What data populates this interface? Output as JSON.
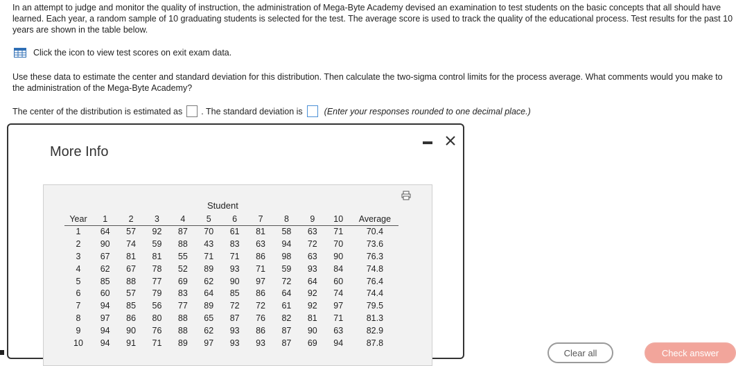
{
  "intro_text": "In an attempt to judge and monitor the quality of instruction, the administration of Mega-Byte Academy devised an examination to test students on the basic concepts that all should have learned. Each year, a random sample of 10 graduating students is selected for the test. The average score is used to track the quality of the educational process. Test results for the past 10 years are shown in the table below.",
  "icon_row": {
    "icon": "table-icon",
    "text": "Click the icon to view test scores on exit exam data."
  },
  "question_text": "Use these data to estimate the center and standard deviation for this distribution. Then calculate the two-sigma control limits for the process average. What comments would you make to the administration of the Mega-Byte Academy?",
  "answer": {
    "center_label": "The center of the distribution is estimated as",
    "center_value": "",
    "std_label": ". The standard deviation is",
    "std_value": "",
    "hint": "(Enter your responses rounded to one decimal place.)"
  },
  "modal": {
    "title": "More Info",
    "student_header": "Student",
    "columns": [
      "Year",
      "1",
      "2",
      "3",
      "4",
      "5",
      "6",
      "7",
      "8",
      "9",
      "10",
      "Average"
    ],
    "rows": [
      [
        "1",
        "64",
        "57",
        "92",
        "87",
        "70",
        "61",
        "81",
        "58",
        "63",
        "71",
        "70.4"
      ],
      [
        "2",
        "90",
        "74",
        "59",
        "88",
        "43",
        "83",
        "63",
        "94",
        "72",
        "70",
        "73.6"
      ],
      [
        "3",
        "67",
        "81",
        "81",
        "55",
        "71",
        "71",
        "86",
        "98",
        "63",
        "90",
        "76.3"
      ],
      [
        "4",
        "62",
        "67",
        "78",
        "52",
        "89",
        "93",
        "71",
        "59",
        "93",
        "84",
        "74.8"
      ],
      [
        "5",
        "85",
        "88",
        "77",
        "69",
        "62",
        "90",
        "97",
        "72",
        "64",
        "60",
        "76.4"
      ],
      [
        "6",
        "60",
        "57",
        "79",
        "83",
        "64",
        "85",
        "86",
        "64",
        "92",
        "74",
        "74.4"
      ],
      [
        "7",
        "94",
        "85",
        "56",
        "77",
        "89",
        "72",
        "72",
        "61",
        "92",
        "97",
        "79.5"
      ],
      [
        "8",
        "97",
        "86",
        "80",
        "88",
        "65",
        "87",
        "76",
        "82",
        "81",
        "71",
        "81.3"
      ],
      [
        "9",
        "94",
        "90",
        "76",
        "88",
        "62",
        "93",
        "86",
        "87",
        "90",
        "63",
        "82.9"
      ],
      [
        "10",
        "94",
        "91",
        "71",
        "89",
        "97",
        "93",
        "93",
        "87",
        "69",
        "94",
        "87.8"
      ]
    ]
  },
  "buttons": {
    "clear": "Clear all",
    "check": "Check answer"
  },
  "colors": {
    "accent_blue": "#2f6fb5",
    "check_button": "#f2a59b"
  }
}
